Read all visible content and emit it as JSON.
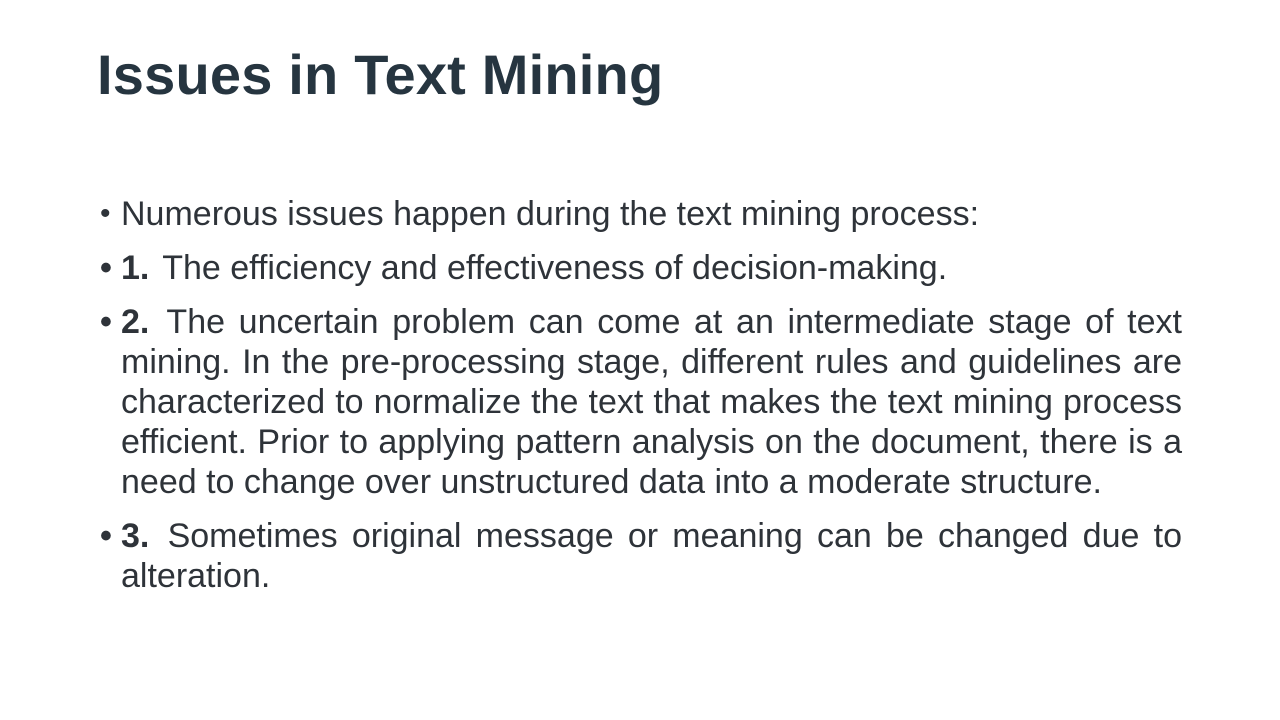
{
  "slide": {
    "title": "Issues in Text Mining",
    "intro": "Numerous issues happen during the text mining process:",
    "items": [
      {
        "number": "1.",
        "text": "The efficiency and effectiveness of decision-making."
      },
      {
        "number": "2.",
        "text": "The uncertain problem can come at an intermediate stage of text mining. In the pre-processing stage, different rules and guidelines are characterized to normalize the text that makes the text mining process efficient.  Prior to applying pattern analysis on the document, there is a need to change over unstructured data into a moderate structure."
      },
      {
        "number": "3.",
        "text": "Sometimes original message or meaning can be changed due to alteration."
      }
    ]
  }
}
